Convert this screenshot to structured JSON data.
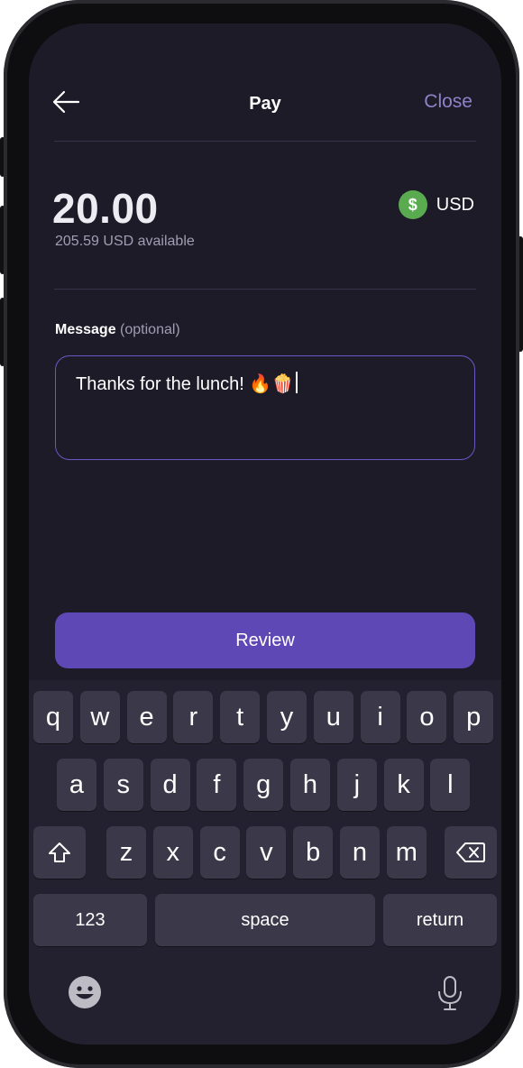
{
  "header": {
    "back_icon": "arrow-left-icon",
    "title": "Pay",
    "close_label": "Close"
  },
  "amount": {
    "value": "20.00",
    "available": "205.59 USD available",
    "currency_symbol": "$",
    "currency_code": "USD",
    "currency_icon_color": "#5aab4f"
  },
  "message": {
    "label": "Message",
    "optional_label": "(optional)",
    "value": "Thanks for the lunch! 🔥🍿"
  },
  "review": {
    "label": "Review",
    "color": "#5d48b5"
  },
  "keyboard": {
    "row1": [
      "q",
      "w",
      "e",
      "r",
      "t",
      "y",
      "u",
      "i",
      "o",
      "p"
    ],
    "row2": [
      "a",
      "s",
      "d",
      "f",
      "g",
      "h",
      "j",
      "k",
      "l"
    ],
    "row3": [
      "z",
      "x",
      "c",
      "v",
      "b",
      "n",
      "m"
    ],
    "shift_icon": "shift-icon",
    "backspace_icon": "backspace-icon",
    "numbers_label": "123",
    "space_label": "space",
    "return_label": "return",
    "emoji_icon": "emoji-icon",
    "mic_icon": "microphone-icon"
  },
  "colors": {
    "background": "#1e1b29",
    "accent": "#8f82c9",
    "border": "#6b58c4"
  }
}
